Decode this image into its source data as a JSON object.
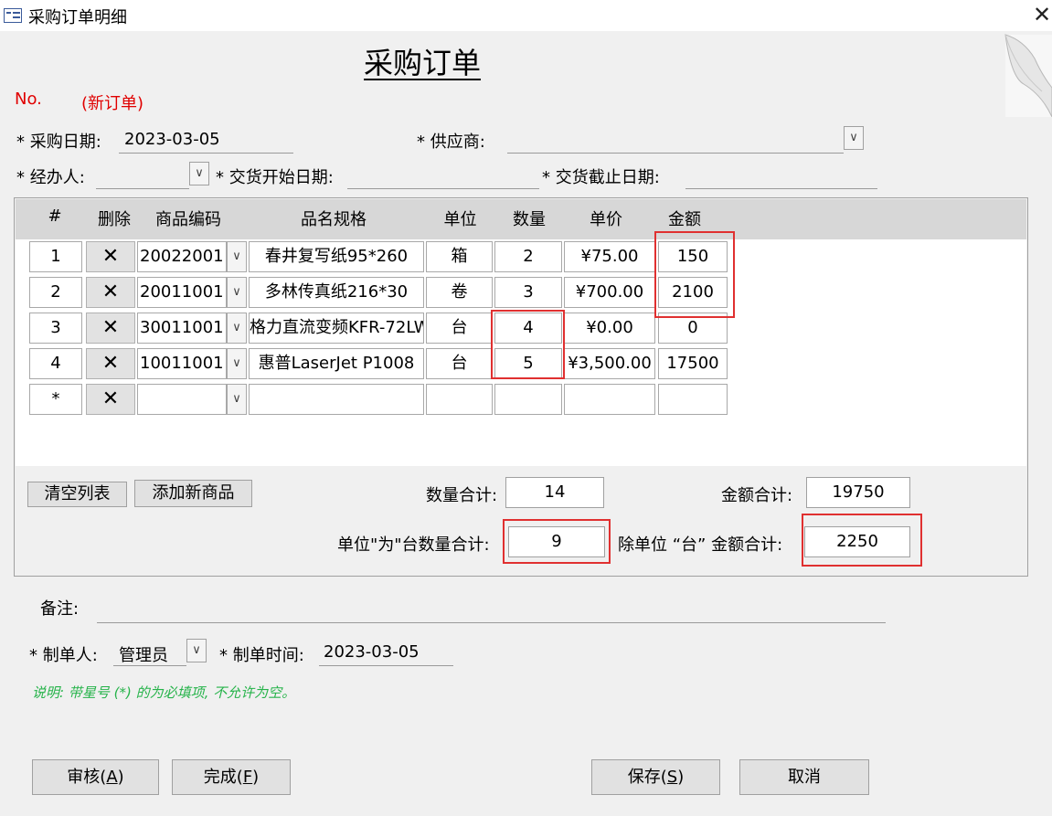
{
  "window": {
    "title": "采购订单明细",
    "close_glyph": "✕"
  },
  "form": {
    "title": "采购订单",
    "no_label": "No.",
    "no_value": "(新订单)",
    "purchase_date_label": "* 采购日期:",
    "purchase_date_value": "2023-03-05",
    "supplier_label": "* 供应商:",
    "supplier_value": "",
    "handler_label": "* 经办人:",
    "handler_value": "",
    "delivery_start_label": "* 交货开始日期:",
    "delivery_start_value": "",
    "delivery_end_label": "* 交货截止日期:",
    "delivery_end_value": ""
  },
  "grid": {
    "columns": [
      "#",
      "删除",
      "商品编码",
      "品名规格",
      "单位",
      "数量",
      "单价",
      "金额"
    ],
    "delete_glyph": "✕",
    "dropdown_glyph": "∨",
    "rows": [
      {
        "no": "1",
        "code": "20022001",
        "name": "春井复写纸95*260",
        "unit": "箱",
        "qty": "2",
        "price": "¥75.00",
        "amount": "150"
      },
      {
        "no": "2",
        "code": "20011001",
        "name": "多林传真纸216*30",
        "unit": "卷",
        "qty": "3",
        "price": "¥700.00",
        "amount": "2100"
      },
      {
        "no": "3",
        "code": "30011001",
        "name": "格力直流变频KFR-72LW",
        "unit": "台",
        "qty": "4",
        "price": "¥0.00",
        "amount": "0"
      },
      {
        "no": "4",
        "code": "10011001",
        "name": "惠普LaserJet P1008",
        "unit": "台",
        "qty": "5",
        "price": "¥3,500.00",
        "amount": "17500"
      },
      {
        "no": "*",
        "code": "",
        "name": "",
        "unit": "",
        "qty": "",
        "price": "",
        "amount": ""
      }
    ]
  },
  "totals": {
    "clear_label": "清空列表",
    "add_label": "添加新商品",
    "qty_total_label": "数量合计:",
    "qty_total_value": "14",
    "amount_total_label": "金额合计:",
    "amount_total_value": "19750",
    "unit_qty_label": "单位\"为\"台数量合计:",
    "unit_qty_value": "9",
    "except_amount_label": "除单位 “台” 金额合计:",
    "except_amount_value": "2250"
  },
  "footer": {
    "remark_label": "备注:",
    "remark_value": "",
    "maker_label": "* 制单人:",
    "maker_value": "管理员",
    "make_time_label": "* 制单时间:",
    "make_time_value": "2023-03-05",
    "note": "说明: 带星号 (*) 的为必填项, 不允许为空。"
  },
  "buttons": {
    "audit_text": "审核(",
    "audit_key": "A",
    "finish_text": "完成(",
    "finish_key": "F",
    "save_text": "保存(",
    "save_key": "S",
    "close_paren": ")",
    "cancel": "取消"
  },
  "colors": {
    "required_note": "#26b34a",
    "new_order": "#e00000",
    "highlight": "#e03030"
  }
}
